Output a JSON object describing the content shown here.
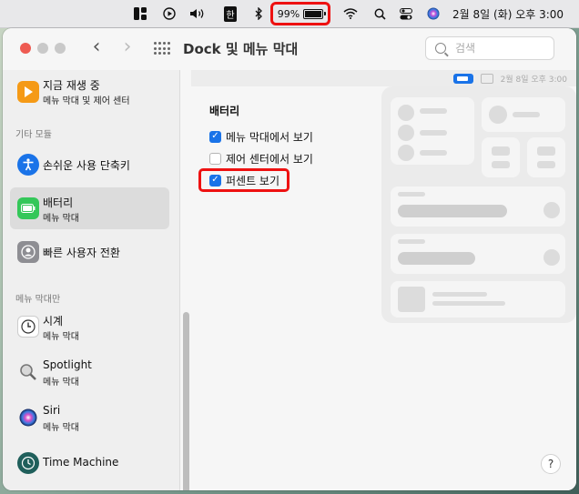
{
  "menubar": {
    "battery_percent": "99%",
    "input_method": "한",
    "datetime": "2월 8일 (화) 오후  3:00"
  },
  "window": {
    "title": "Dock 및 메뉴 막대",
    "search_placeholder": "검색",
    "help_label": "?"
  },
  "sidebar": {
    "top_item": {
      "label": "지금 재생 중",
      "sub": "메뉴 막대 및 제어 센터"
    },
    "section_other": "기타 모듈",
    "accessibility": {
      "label": "손쉬운 사용 단축키"
    },
    "battery": {
      "label": "배터리",
      "sub": "메뉴 막대"
    },
    "fast_user": {
      "label": "빠른 사용자 전환"
    },
    "section_menubar_only": "메뉴 막대만",
    "clock": {
      "label": "시계",
      "sub": "메뉴 막대"
    },
    "spotlight": {
      "label": "Spotlight",
      "sub": "메뉴 막대"
    },
    "siri": {
      "label": "Siri",
      "sub": "메뉴 막대"
    },
    "time_machine": {
      "label": "Time Machine"
    }
  },
  "content": {
    "preview_datetime": "2월 8일 오후 3:00",
    "section_title": "배터리",
    "options": [
      {
        "label": "메뉴 막대에서 보기",
        "checked": true
      },
      {
        "label": "제어 센터에서 보기",
        "checked": false
      },
      {
        "label": "퍼센트 보기",
        "checked": true
      }
    ]
  },
  "colors": {
    "accent": "#1a73e8",
    "highlight": "#ee1111"
  }
}
